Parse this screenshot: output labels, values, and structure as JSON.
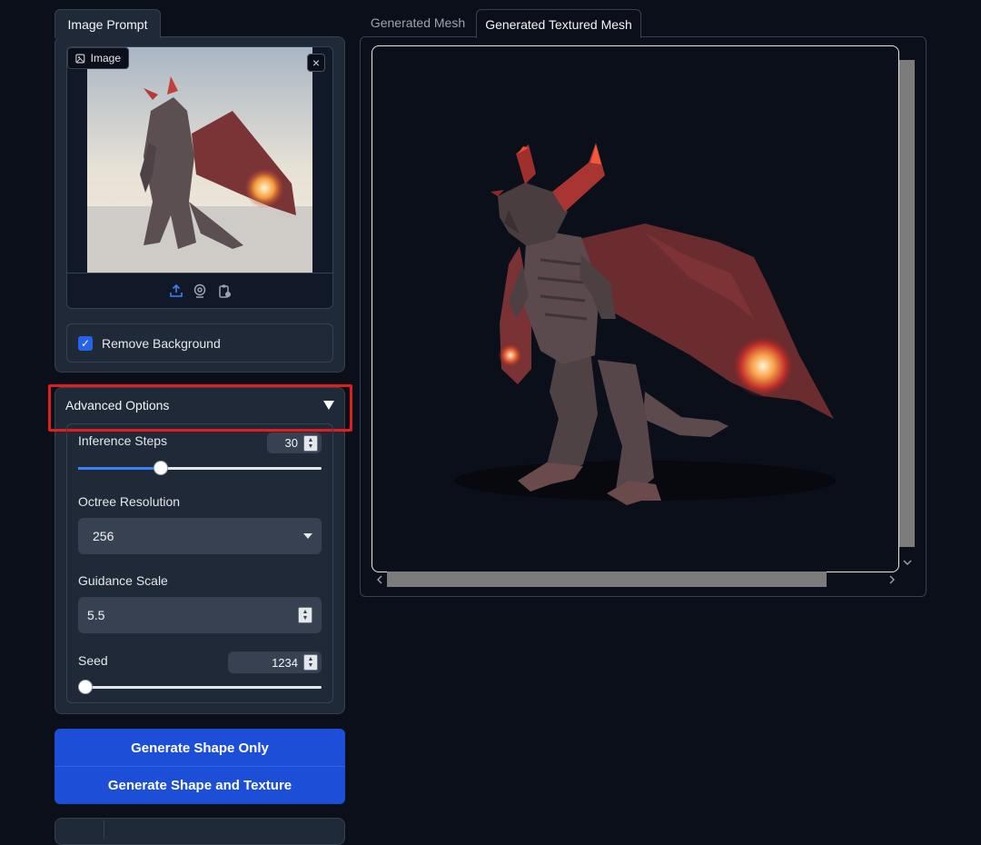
{
  "left_tabs": {
    "active": "Image Prompt"
  },
  "image_input": {
    "label": "Image",
    "close_symbol": "×"
  },
  "remove_background": {
    "label": "Remove Background",
    "checked": true
  },
  "advanced": {
    "title": "Advanced Options",
    "inference_steps": {
      "label": "Inference Steps",
      "value": "30",
      "fraction": 0.33
    },
    "octree_resolution": {
      "label": "Octree Resolution",
      "value": "256"
    },
    "guidance_scale": {
      "label": "Guidance Scale",
      "value": "5.5"
    },
    "seed": {
      "label": "Seed",
      "value": "1234",
      "fraction": 0.0
    }
  },
  "buttons": {
    "shape_only": "Generate Shape Only",
    "shape_and_texture": "Generate Shape and Texture"
  },
  "right_tabs": {
    "inactive": "Generated Mesh",
    "active": "Generated Textured Mesh"
  },
  "colors": {
    "accent": "#2563eb",
    "button": "#1d4ed8",
    "highlight": "#e11d1d",
    "panel": "#1f2937",
    "background": "#0b0f19"
  }
}
